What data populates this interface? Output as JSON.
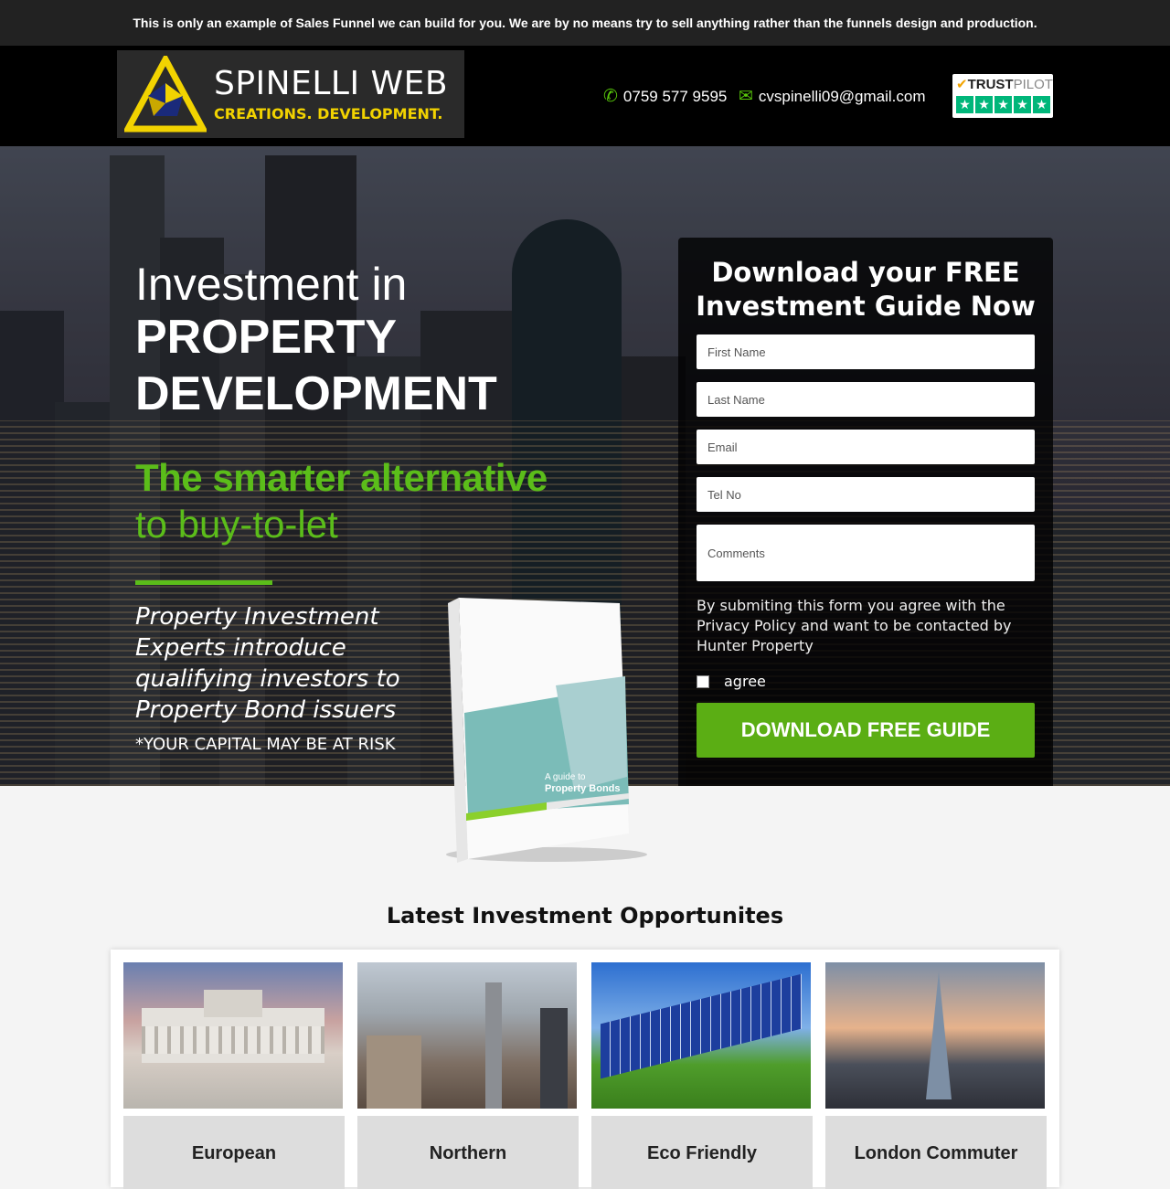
{
  "topbar": {
    "text": "This is only an example of Sales Funnel we can build for you. We are by no means try to sell anything rather than the funnels design and production."
  },
  "header": {
    "logo": {
      "title": "SPINELLI WEB",
      "tagline": "CREATIONS. DEVELOPMENT."
    },
    "phone": "0759 577 9595",
    "email": "cvspinelli09@gmail.com",
    "trustpilot": {
      "brand_bold": "TRUST",
      "brand_light": "PILOT",
      "stars": "★"
    }
  },
  "hero": {
    "headline_light": "Investment in",
    "headline_bold_1": "PROPERTY",
    "headline_bold_2": "DEVELOPMENT",
    "sub_bold": "The smarter alternative",
    "sub_light": "to buy-to-let",
    "intro": "Property Investment Experts introduce qualifying investors to Property Bond issuers",
    "risk": "*YOUR CAPITAL MAY BE AT RISK",
    "book": {
      "line1": "A guide to",
      "line2": "Property Bonds"
    }
  },
  "form": {
    "title": "Download your FREE Investment Guide Now",
    "fields": {
      "first_name": "First Name",
      "last_name": "Last Name",
      "email": "Email",
      "tel": "Tel No",
      "comments": "Comments"
    },
    "consent": "By submiting this form you agree with the Privacy Policy and want to be contacted by Hunter Property",
    "agree_label": "agree",
    "submit": "DOWNLOAD FREE GUIDE"
  },
  "opportunities": {
    "title": "Latest Investment Opportunites",
    "cards": [
      {
        "caption": "European"
      },
      {
        "caption": "Northern"
      },
      {
        "caption": "Eco Friendly"
      },
      {
        "caption": "London Commuter"
      }
    ]
  },
  "colors": {
    "accent_green": "#5bae14",
    "headline_green": "#5bbd1a",
    "logo_yellow": "#f2d300"
  }
}
